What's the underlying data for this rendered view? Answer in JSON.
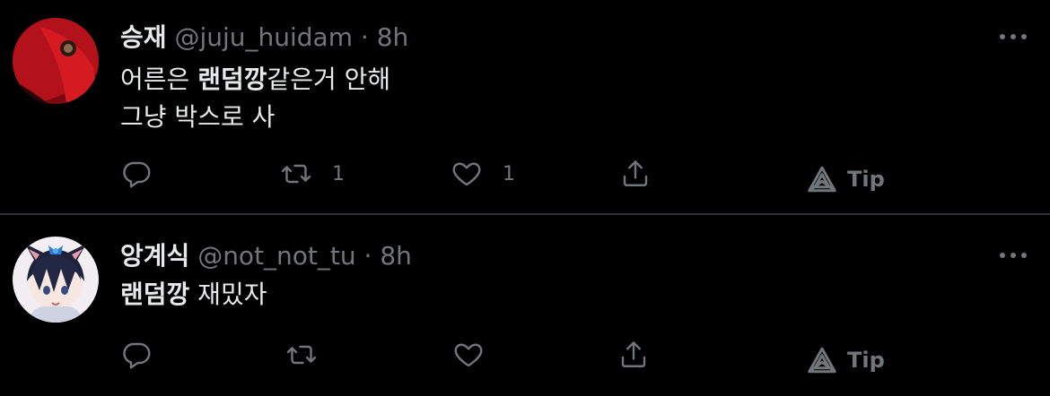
{
  "tweets": [
    {
      "name": "승재",
      "handle": "@juju_huidam",
      "sep": "·",
      "time": "8h",
      "lines": [
        {
          "pre": "어른은 ",
          "bold": "랜덤깡",
          "post": "같은거 안해"
        },
        {
          "pre": "그냥 박스로 사",
          "bold": "",
          "post": ""
        }
      ],
      "retweet_count": "1",
      "like_count": "1",
      "tip_label": "Tip"
    },
    {
      "name": "앙계식",
      "handle": "@not_not_tu",
      "sep": "·",
      "time": "8h",
      "lines": [
        {
          "pre": "",
          "bold": "랜덤깡",
          "post": " 재밌자"
        }
      ],
      "retweet_count": "",
      "like_count": "",
      "tip_label": "Tip"
    }
  ],
  "colors": {
    "background": "#000000",
    "text": "#e7e9ea",
    "muted": "#71767b",
    "divider": "#2f3336"
  },
  "icons": [
    "reply-icon",
    "retweet-icon",
    "like-icon",
    "share-icon",
    "tip-icon",
    "more-icon"
  ]
}
